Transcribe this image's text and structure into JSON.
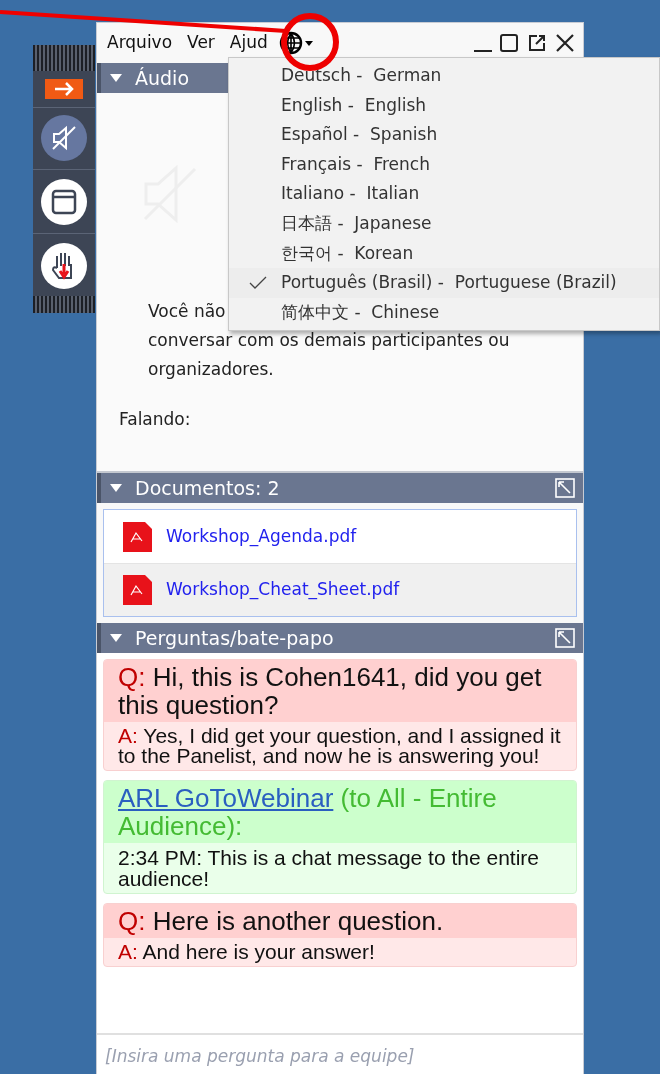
{
  "menu_bar": {
    "items": [
      {
        "label": "Arquivo"
      },
      {
        "label": "Ver"
      },
      {
        "label": "Ajud"
      }
    ]
  },
  "language_menu": {
    "items": [
      {
        "label": "Deutsch -  German",
        "selected": false
      },
      {
        "label": "English -  English",
        "selected": false
      },
      {
        "label": "Español -  Spanish",
        "selected": false
      },
      {
        "label": "Français -  French",
        "selected": false
      },
      {
        "label": "Italiano -  Italian",
        "selected": false
      },
      {
        "label": "日本語 -  Japanese",
        "selected": false
      },
      {
        "label": "한국어 -  Korean",
        "selected": false
      },
      {
        "label": "Português (Brasil) -  Portuguese (Brazil)",
        "selected": true
      },
      {
        "label": "简体中文 -  Chinese",
        "selected": false
      }
    ]
  },
  "audio": {
    "title": "Áudio",
    "expanded": true,
    "lines": [
      "Você não",
      "conversar com os demais participantes ou",
      "organizadores."
    ],
    "speaking_label": "Falando:"
  },
  "documents": {
    "title": "Documentos: 2",
    "expanded": true,
    "files": [
      {
        "name": "Workshop_Agenda.pdf",
        "selected": false
      },
      {
        "name": "Workshop_Cheat_Sheet.pdf",
        "selected": true
      }
    ]
  },
  "questions": {
    "title": "Perguntas/bate-papo",
    "expanded": true,
    "messages": [
      {
        "kind": "question",
        "prefix": "Q:",
        "text": "Hi, this is Cohen1641, did you get this question?",
        "answer_prefix": "A:",
        "answer": "Yes, I did get your question, and I assigned it to the Panelist, and now he is answering you!"
      },
      {
        "kind": "chat",
        "sender": "ARL GoToWebinar",
        "recipient": "(to All - Entire Audience):",
        "text": "2:34 PM: This is a chat message to the entire audience!"
      },
      {
        "kind": "question",
        "prefix": "Q:",
        "text": "Here is another question.",
        "answer_prefix": "A:",
        "answer": "And here is your answer!"
      }
    ]
  },
  "input": {
    "placeholder": "[Insira uma pergunta para a equipe]"
  }
}
